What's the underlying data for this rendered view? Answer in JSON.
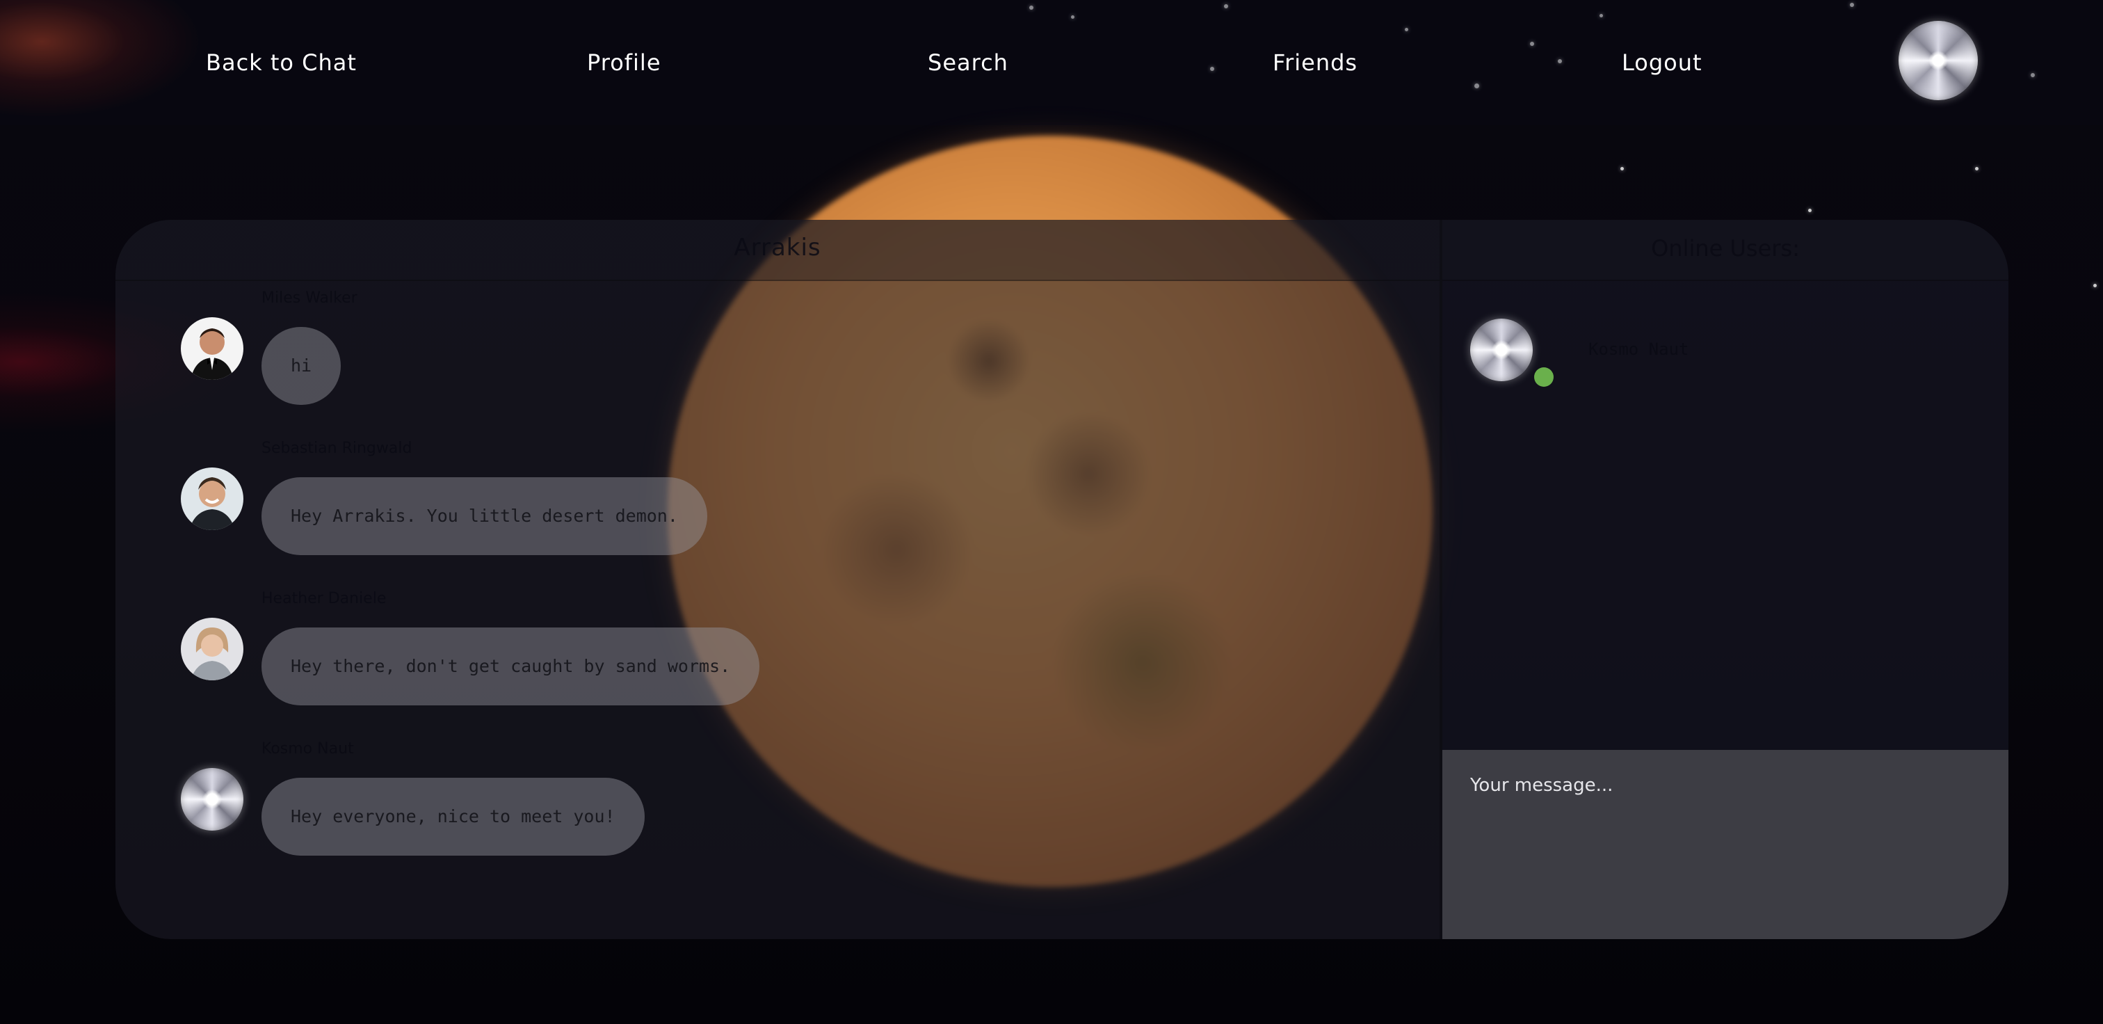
{
  "nav": {
    "back_to_chat": "Back to Chat",
    "profile": "Profile",
    "search": "Search",
    "friends": "Friends",
    "logout": "Logout",
    "avatar_icon": "silver-orb-avatar"
  },
  "chat": {
    "room_name": "Arrakis",
    "messages": [
      {
        "author": "Miles Walker",
        "text": "hi",
        "avatar_icon": "user-photo-tuxedo"
      },
      {
        "author": "Sebastian Ringwald",
        "text": "Hey Arrakis. You little desert demon.",
        "avatar_icon": "user-photo-smiling"
      },
      {
        "author": "Heather Daniele",
        "text": "Hey there, don't get caught by sand worms.",
        "avatar_icon": "user-photo-woman"
      },
      {
        "author": "Kosmo Naut",
        "text": "Hey everyone, nice to meet you!",
        "avatar_icon": "silver-orb-avatar"
      }
    ]
  },
  "online": {
    "title": "Online Users:",
    "users": [
      {
        "name": "Kosmo Naut",
        "status": "online",
        "status_color": "#6ab04c",
        "avatar_icon": "silver-orb-avatar"
      }
    ]
  },
  "composer": {
    "placeholder": "Your message..."
  },
  "theme": {
    "accent_online": "#6ab04c",
    "composer_bg": "#3d3d44",
    "text_light": "#ffffff"
  }
}
